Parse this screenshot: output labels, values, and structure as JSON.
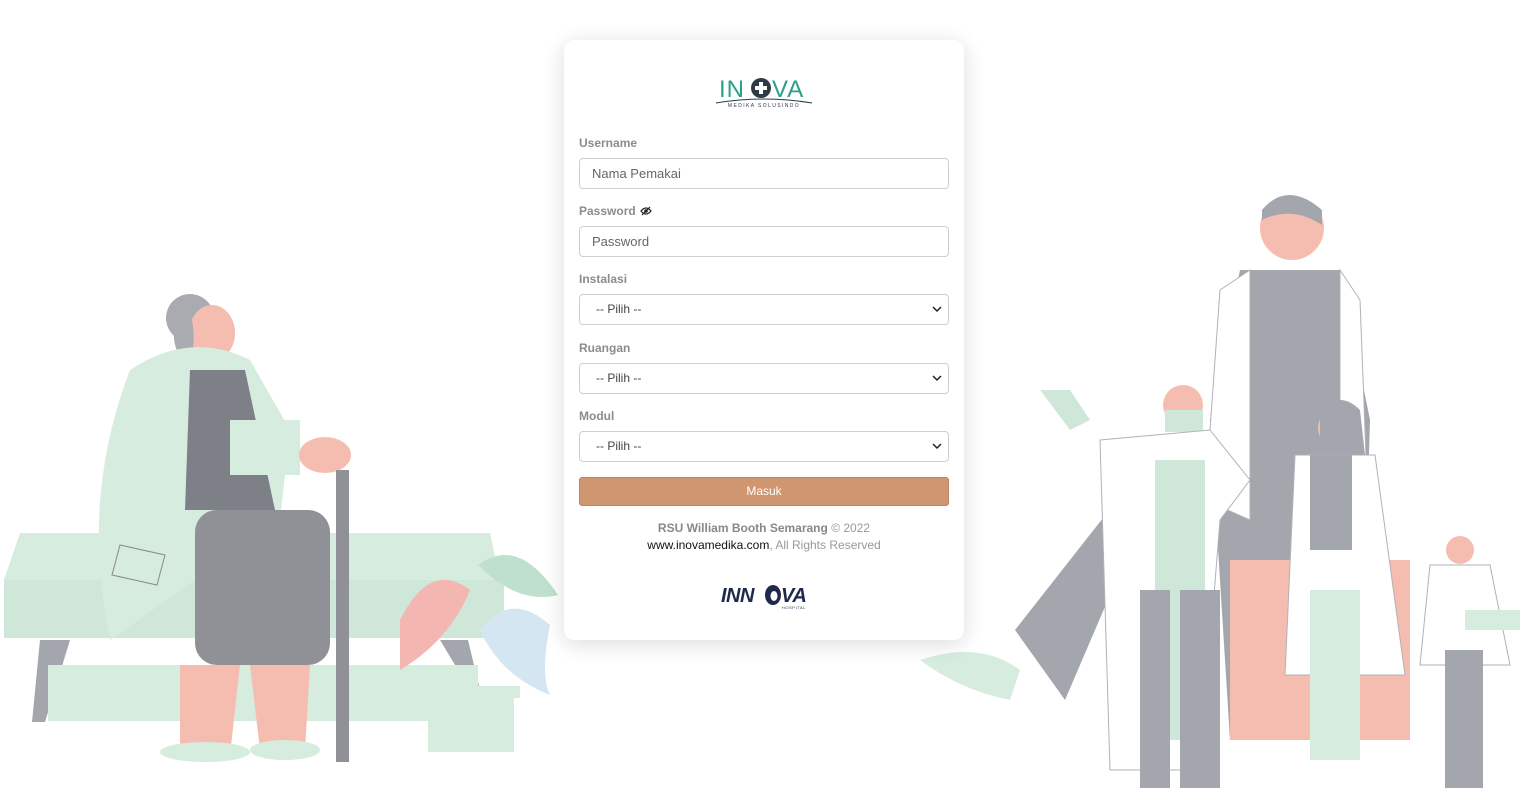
{
  "brand": {
    "logo_text": "INOVA",
    "logo_subtitle": "MEDIKA SOLUSINDO",
    "accent_color": "#2aa08a",
    "dark_color": "#2f3a44"
  },
  "form": {
    "username": {
      "label": "Username",
      "placeholder": "Nama Pemakai"
    },
    "password": {
      "label": "Password",
      "placeholder": "Password",
      "toggle_icon": "eye-slash-icon"
    },
    "instalasi": {
      "label": "Instalasi",
      "selected": "-- Pilih --"
    },
    "ruangan": {
      "label": "Ruangan",
      "selected": "-- Pilih --"
    },
    "modul": {
      "label": "Modul",
      "selected": "-- Pilih --"
    },
    "submit_label": "Masuk",
    "submit_color": "#d09670"
  },
  "footer": {
    "hospital": "RSU William Booth Semarang",
    "copyright": "© 2022",
    "website": "www.inovamedika.com",
    "rights": ", All Rights Reserved",
    "bottom_logo_text": "INNOVA",
    "bottom_logo_subtext": "HOSPITAL"
  }
}
